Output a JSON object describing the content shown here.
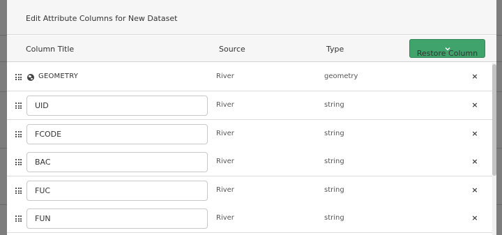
{
  "modal": {
    "title": "Edit Attribute Columns for New Dataset",
    "restore_label": "Restore Column"
  },
  "headers": {
    "title": "Column Title",
    "source": "Source",
    "type": "Type"
  },
  "rows": [
    {
      "title": "GEOMETRY",
      "source": "River",
      "type": "geometry"
    },
    {
      "title": "UID",
      "source": "River",
      "type": "string"
    },
    {
      "title": "FCODE",
      "source": "River",
      "type": "string"
    },
    {
      "title": "BAC",
      "source": "River",
      "type": "string"
    },
    {
      "title": "FUC",
      "source": "River",
      "type": "string"
    },
    {
      "title": "FUN",
      "source": "River",
      "type": "string"
    }
  ],
  "remove_glyph": "×",
  "icons": {
    "drag": "drag-handle-icon",
    "geometry": "globe-icon",
    "remove": "close-icon",
    "restore": "chevron-down-icon"
  },
  "colors": {
    "accent": "#3fa36b"
  }
}
